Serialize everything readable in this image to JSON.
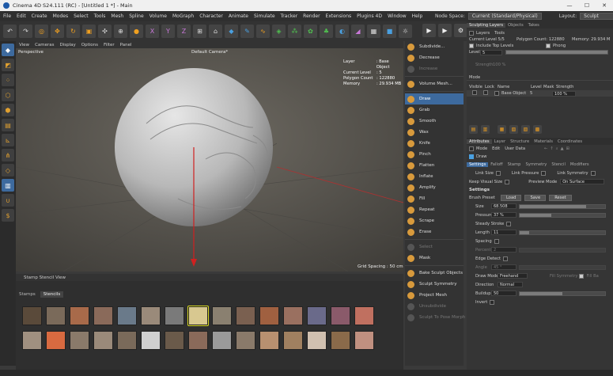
{
  "window": {
    "title": "Cinema 4D S24.111 (RC) - [Untitled 1 *] - Main",
    "controls": [
      "—",
      "☐",
      "✕"
    ]
  },
  "menu": {
    "items": [
      "File",
      "Edit",
      "Create",
      "Modes",
      "Select",
      "Tools",
      "Mesh",
      "Spline",
      "Volume",
      "MoGraph",
      "Character",
      "Animate",
      "Simulate",
      "Tracker",
      "Render",
      "Extensions",
      "Plugins 4D",
      "Window",
      "Help"
    ],
    "node_space_label": "Node Space:",
    "node_space_value": "Current (Standard/Physical)",
    "layout_label": "Layout:",
    "layout_value": "Sculpt"
  },
  "toolbar": {
    "icons": [
      "undo-icon",
      "redo-icon",
      "live-select-icon",
      "move-icon",
      "rotate-icon",
      "scale-icon",
      "transform-icon",
      "place-icon",
      "select-icon",
      "x-axis-icon",
      "y-axis-icon",
      "z-axis-icon",
      "world-icon",
      "make-editable-icon",
      "cube-icon",
      "pen-icon",
      "spline-icon",
      "subdivision-icon",
      "cloner-icon",
      "deformer-icon",
      "effector-icon",
      "field-icon",
      "tag-icon",
      "floor-icon",
      "camera-icon",
      "light-icon"
    ]
  },
  "viewport": {
    "menu": [
      "View",
      "Cameras",
      "Display",
      "Options",
      "Filter",
      "Panel"
    ],
    "name": "Perspective",
    "camera": "Default Camera*",
    "hud": [
      {
        "k": "Layer",
        "v": ": Base Object"
      },
      {
        "k": "Current Level",
        "v": ": 5"
      },
      {
        "k": "Polygon Count",
        "v": ": 122880"
      },
      {
        "k": "Memory",
        "v": ": 29.934 MB"
      }
    ],
    "grid_spacing": "Grid Spacing : 50 cm"
  },
  "stencil_view": {
    "title": "Stamp Stencil View",
    "tabs": [
      "Stamps",
      "Stencils"
    ],
    "row1_colors": [
      "#5a4a3a",
      "#7a6a5a",
      "#a86a4a",
      "#8a6a5a",
      "#6a7a8a",
      "#9a8a7a",
      "#7a7a7a",
      "#d8c890",
      "#8a8070",
      "#7a6050",
      "#a06040",
      "#9a7060",
      "#6a6a8a",
      "#8a5a6a",
      "#c07060"
    ],
    "row2_colors": [
      "#a09080",
      "#d86a40",
      "#8a7a6a",
      "#9a8a7a",
      "#7a6a5a",
      "#d0d0d0",
      "#6a5a4a",
      "#8a6a5a",
      "#9a9a9a",
      "#8a7a6a",
      "#b89070",
      "#a08060",
      "#d0c0b0",
      "#8a6a4a",
      "#c09080"
    ]
  },
  "sculpt_tools": {
    "top": [
      "Subdivide...",
      "Decrease",
      "Increase",
      "Volume Mesh..."
    ],
    "brushes": [
      "Draw",
      "Grab",
      "Smooth",
      "Wax",
      "Knife",
      "Pinch",
      "Flatten",
      "Inflate",
      "Amplify",
      "Fill",
      "Repeat",
      "Scrape",
      "Erase",
      "Select",
      "Mask"
    ],
    "bottom": [
      "Bake Sculpt Objects",
      "Sculpt Symmetry",
      "Project Mesh",
      "Unsubdivide",
      "Sculpt To Pose Morph"
    ],
    "active": "Draw",
    "disabled": [
      "Increase",
      "Select",
      "Unsubdivide",
      "Sculpt To Pose Morph"
    ]
  },
  "layers": {
    "tabs": [
      "Sculpting Layers",
      "Objects",
      "Takes"
    ],
    "subtabs": [
      "Layers",
      "Tools"
    ],
    "current_level": "Current Level 5/5",
    "polygon_count": "Polygon Count: 122880",
    "memory": "Memory: 29.934 M",
    "include_top": "Include Top Levels",
    "phong": "Phong",
    "level_label": "Level",
    "level_value": "5",
    "strength_label": "Strength",
    "strength_value": "100 %",
    "mode_label": "Mode",
    "cols": [
      "Visible",
      "Lock",
      "Name",
      "Level",
      "Mask",
      "Strength"
    ],
    "row": {
      "name": "Base Object",
      "level": "5",
      "strength": "100 %"
    }
  },
  "attributes": {
    "tabs": [
      "Attributes",
      "Layer",
      "Structure",
      "Materials",
      "Coordinates"
    ],
    "menu": [
      "Mode",
      "Edit",
      "User Data"
    ],
    "object": "Draw",
    "subtabs": [
      "Settings",
      "Falloff",
      "Stamp",
      "Symmetry",
      "Stencil",
      "Modifiers"
    ],
    "link_size": "Link Size",
    "link_pressure": "Link Pressure",
    "link_symmetry": "Link Symmetry",
    "keep_visual": "Keep Visual Size",
    "preview_mode_label": "Preview Mode",
    "preview_mode_value": "On Surface",
    "settings_hdr": "Settings",
    "brush_preset_label": "Brush Preset",
    "load": "Load",
    "save": "Save",
    "reset": "Reset",
    "size_label": "Size",
    "size_value": "68.508",
    "size_level": 0.78,
    "pressure_label": "Pressure",
    "pressure_value": "37 %",
    "pressure_level": 0.37,
    "steady_label": "Steady Stroke",
    "length_label": "Length",
    "length_value": "11",
    "length_level": 0.11,
    "spacing_label": "Spacing",
    "percent_label": "Percent",
    "percent_value": "2",
    "edge_label": "Edge Detect",
    "angle_label": "Angle",
    "angle_value": "45 °",
    "draw_mode_label": "Draw Mode",
    "draw_mode_value": "Freehand",
    "fill_symmetry": "Fill Symmetry",
    "fill_b": "Fill Ba",
    "direction_label": "Direction",
    "direction_value": "Normal",
    "buildup_label": "Buildup",
    "buildup_value": "50",
    "buildup_level": 0.5,
    "invert_label": "Invert"
  }
}
